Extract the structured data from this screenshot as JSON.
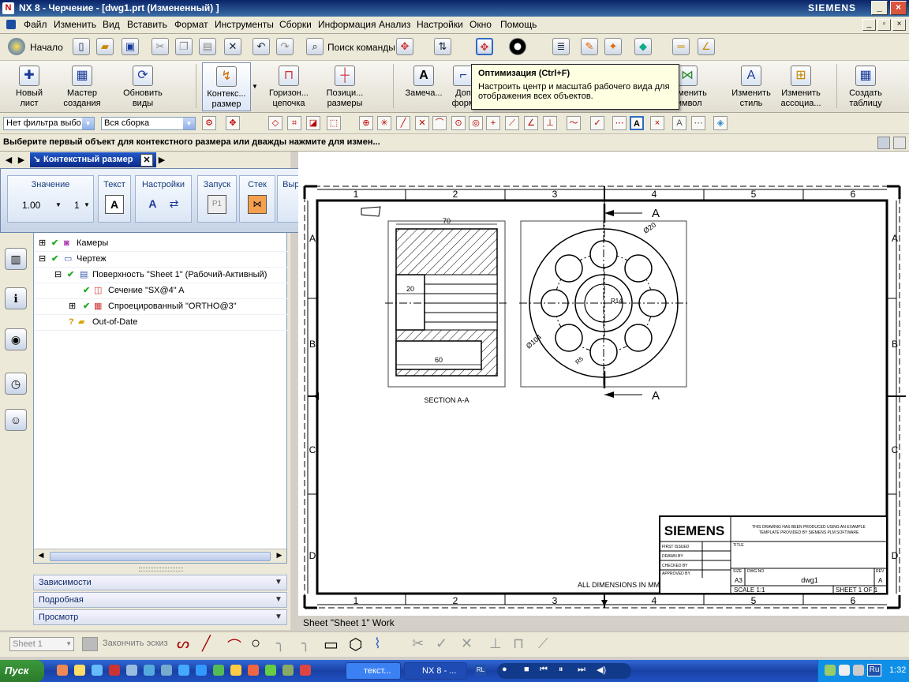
{
  "window": {
    "title": "NX 8 - Черчение - [dwg1.prt (Измененный) ]",
    "brand": "SIEMENS",
    "min": "_",
    "max": "□",
    "close": "×"
  },
  "menu": [
    "Файл",
    "Изменить",
    "Вид",
    "Вставить",
    "Формат",
    "Инструменты",
    "Сборки",
    "Информация",
    "Анализ",
    "Настройки",
    "Окно",
    "Помощь"
  ],
  "toolbar": {
    "start_label": "Начало",
    "find_label": "Поиск команды"
  },
  "ribbon": [
    {
      "label1": "Новый",
      "label2": "лист",
      "icon": "new-sheet-icon"
    },
    {
      "label1": "Мастер",
      "label2": "создания",
      "icon": "view-wizard-icon"
    },
    {
      "label1": "Обновить",
      "label2": "виды",
      "icon": "update-views-icon"
    },
    {
      "label1": "Контекс...",
      "label2": "размер",
      "icon": "rapid-dimension-icon"
    },
    {
      "label1": "Горизон...",
      "label2": "цепочка",
      "icon": "chain-dimension-icon"
    },
    {
      "label1": "Позици...",
      "label2": "размеры",
      "icon": "ordinate-dimension-icon"
    },
    {
      "label1": "Замеча...",
      "label2": "",
      "icon": "note-icon"
    },
    {
      "label1": "Доп",
      "label2": "форм",
      "icon": "feature-frame-icon"
    },
    {
      "label1": "Изменить",
      "label2": "символ",
      "icon": "edit-symbol-icon"
    },
    {
      "label1": "Изменить",
      "label2": "стиль",
      "icon": "edit-style-icon"
    },
    {
      "label1": "Изменить",
      "label2": "ассоциа...",
      "icon": "edit-association-icon"
    },
    {
      "label1": "Создать",
      "label2": "таблицу",
      "icon": "create-table-icon"
    }
  ],
  "tooltip": {
    "title": "Оптимизация (Ctrl+F)",
    "body": "Настроить центр и масштаб рабочего вида для отображения всех объектов."
  },
  "filters": {
    "type_filter": "Нет фильтра выбо",
    "scope": "Вся сборка"
  },
  "status_text": "Выберите первый объект для контекстного размера или дважды нажмите для измен...",
  "dim_panel": {
    "title": "Контекстный размер",
    "groups": {
      "value": "Значение",
      "text": "Текст",
      "settings": "Настройки",
      "launch": "Запуск",
      "stack": "Стек",
      "align": "Выравнивание"
    },
    "value": "1.00",
    "precision": "1"
  },
  "tree": [
    {
      "label": "Камеры",
      "indent": 0
    },
    {
      "label": "Чертеж",
      "indent": 0
    },
    {
      "label": "Поверхность \"Sheet 1\" (Рабочий-Активный)",
      "indent": 1
    },
    {
      "label": "Сечение \"SX@4\" A",
      "indent": 2
    },
    {
      "label": "Спроецированный \"ORTHO@3\"",
      "indent": 2
    },
    {
      "label": "Out-of-Date",
      "indent": 1
    }
  ],
  "accordion": [
    "Зависимости",
    "Подробная",
    "Просмотр"
  ],
  "drawing": {
    "col_labels": [
      "1",
      "2",
      "3",
      "4",
      "5",
      "6"
    ],
    "row_labels": [
      "A",
      "B",
      "C",
      "D"
    ],
    "section_marker": "A",
    "dim_70": "70",
    "dim_20": "20",
    "dim_60": "60",
    "dia_20": "Ø20",
    "dia_104": "Ø104",
    "r5": "R5",
    "r14": "R14",
    "section_label": "SECTION A-A",
    "all_dims": "ALL DIMENSIONS IN MM",
    "title_brand": "SIEMENS",
    "note_line1": "THIS DRAWING HAS BEEN PRODUCED USING AN EXAMPLE",
    "note_line2": "TEMPLATE PROVIDED BY SIEMENS PLM SOFTWARE",
    "first_issued": "FIRST ISSUED",
    "drawn_by": "DRAWN BY",
    "checked_by": "CHECKED BY",
    "approved_by": "APPROVED BY",
    "title_lbl": "TITLE",
    "size_lbl": "SIZE",
    "dwg_no_lbl": "DWG NO",
    "rev_lbl": "REV",
    "size": "A3",
    "dwg": "dwg1",
    "rev": "A",
    "scale": "SCALE 1:1",
    "sheet": "SHEET 1 OF 1"
  },
  "sheet_caption": "Sheet \"Sheet 1\" Work",
  "sketch": {
    "sheet_select": "Sheet 1",
    "finish": "Закончить эскиз"
  },
  "taskbar": {
    "start": "Пуск",
    "tasks": [
      "текст...",
      "NX 8 - ..."
    ],
    "lang": "Ru",
    "time": "1:32",
    "rl": "RL"
  }
}
